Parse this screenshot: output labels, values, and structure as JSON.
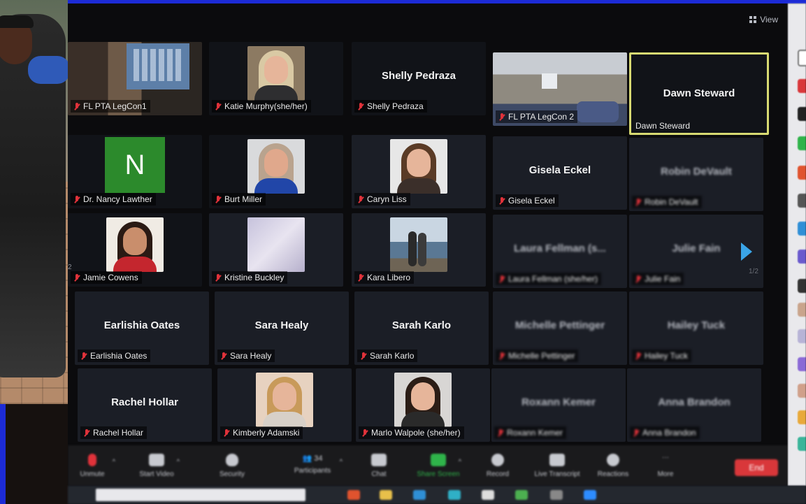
{
  "view_label": "View",
  "participants_count": "34",
  "tiles": [
    {
      "id": "legcon1",
      "label": "FL PTA LegCon1",
      "kind": "room"
    },
    {
      "id": "katie",
      "label": "Katie Murphy(she/her)",
      "kind": "photo"
    },
    {
      "id": "shelly",
      "label": "Shelly Pedraza",
      "big_name": "Shelly Pedraza",
      "kind": "name"
    },
    {
      "id": "legcon2",
      "label": "FL PTA LegCon 2",
      "kind": "room"
    },
    {
      "id": "dawn",
      "label": "Dawn Steward",
      "big_name": "Dawn Steward",
      "kind": "name",
      "active": true
    },
    {
      "id": "nancy",
      "label": "Dr. Nancy Lawther",
      "avatar_letter": "N",
      "kind": "avatar"
    },
    {
      "id": "burt",
      "label": "Burt Miller",
      "kind": "photo"
    },
    {
      "id": "caryn",
      "label": "Caryn Liss",
      "kind": "photo"
    },
    {
      "id": "gisela",
      "label": "Gisela Eckel",
      "big_name": "Gisela Eckel",
      "kind": "name"
    },
    {
      "id": "robin",
      "label": "Robin DeVault",
      "big_name": "Robin DeVault",
      "kind": "name"
    },
    {
      "id": "jamie",
      "label": "Jamie Cowens",
      "kind": "photo"
    },
    {
      "id": "kristine",
      "label": "Kristine Buckley",
      "kind": "photo"
    },
    {
      "id": "kara",
      "label": "Kara Libero",
      "kind": "photo"
    },
    {
      "id": "laura",
      "label": "Laura Fellman (she/her)",
      "big_name": "Laura Fellman (s...",
      "kind": "name"
    },
    {
      "id": "julie",
      "label": "Julie Fain",
      "big_name": "Julie Fain",
      "kind": "name"
    },
    {
      "id": "earlishia",
      "label": "Earlishia Oates",
      "big_name": "Earlishia Oates",
      "kind": "name"
    },
    {
      "id": "sara",
      "label": "Sara Healy",
      "big_name": "Sara Healy",
      "kind": "name"
    },
    {
      "id": "sarah",
      "label": "Sarah Karlo",
      "big_name": "Sarah Karlo",
      "kind": "name"
    },
    {
      "id": "michelle",
      "label": "Michelle Pettinger",
      "big_name": "Michelle Pettinger",
      "kind": "name"
    },
    {
      "id": "hailey",
      "label": "Hailey Tuck",
      "big_name": "Hailey Tuck",
      "kind": "name"
    },
    {
      "id": "rachel",
      "label": "Rachel Hollar",
      "big_name": "Rachel Hollar",
      "kind": "name"
    },
    {
      "id": "kimberly",
      "label": "Kimberly Adamski",
      "kind": "photo"
    },
    {
      "id": "marlo",
      "label": "Marlo Walpole (she/her)",
      "kind": "photo"
    },
    {
      "id": "roxann",
      "label": "Roxann Kemer",
      "big_name": "Roxann Kemer",
      "kind": "name"
    },
    {
      "id": "anna",
      "label": "Anna Brandon",
      "big_name": "Anna Brandon",
      "kind": "name"
    }
  ],
  "toolbar": {
    "unmute": "Unmute",
    "start_video": "Start Video",
    "security": "Security",
    "participants": "Participants",
    "chat": "Chat",
    "share_screen": "Share Screen",
    "record": "Record",
    "live_transcript": "Live Transcript",
    "reactions": "Reactions",
    "more": "More",
    "end": "End"
  },
  "page_indicator": "1/2",
  "prev_page_indicator": "2",
  "colors": {
    "accent_active": "#d8da72",
    "mic_off": "#e0323a",
    "end_red": "#d9373a",
    "share_green": "#2fb34a",
    "arrow_blue": "#3aa5e8",
    "avatar_green": "#2c8a2c"
  }
}
